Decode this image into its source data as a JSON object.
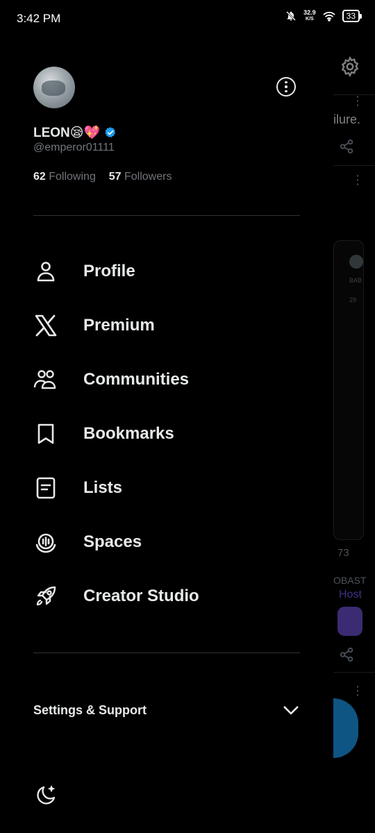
{
  "status_bar": {
    "time": "3:42 PM",
    "net_speed": "32.9",
    "net_unit": "K/S",
    "battery": "33"
  },
  "profile": {
    "name": "LEON😪💖",
    "handle": "@emperor01111",
    "following_count": "62",
    "following_label": "Following",
    "followers_count": "57",
    "followers_label": "Followers"
  },
  "menu": [
    {
      "label": "Profile",
      "icon": "person-icon"
    },
    {
      "label": "Premium",
      "icon": "x-logo-icon"
    },
    {
      "label": "Communities",
      "icon": "communities-icon"
    },
    {
      "label": "Bookmarks",
      "icon": "bookmark-icon"
    },
    {
      "label": "Lists",
      "icon": "list-icon"
    },
    {
      "label": "Spaces",
      "icon": "spaces-icon"
    },
    {
      "label": "Creator Studio",
      "icon": "rocket-icon"
    }
  ],
  "settings": {
    "label": "Settings & Support"
  },
  "background_feed": {
    "snippet": "ilure.",
    "card_name": "BAB",
    "card_count": "29",
    "reply_count": "73",
    "snippet2": "OBAST",
    "snippet3": "Host"
  },
  "colors": {
    "background": "#000000",
    "text": "#e7e9ea",
    "muted": "#71767b",
    "divider": "#2f3336",
    "verified": "#1d9bf0"
  }
}
